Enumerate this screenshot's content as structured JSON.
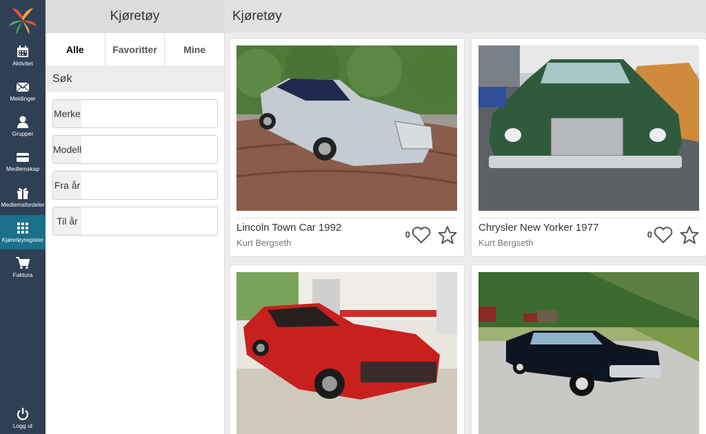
{
  "nav": {
    "items": [
      {
        "label": "Aktivitet",
        "icon": "calendar-icon"
      },
      {
        "label": "Meldinger",
        "icon": "envelope-icon"
      },
      {
        "label": "Grupper",
        "icon": "person-icon"
      },
      {
        "label": "Medlemskap",
        "icon": "card-icon"
      },
      {
        "label": "Medlemsfordeler",
        "icon": "gift-icon"
      },
      {
        "label": "Kjøretøyregister",
        "icon": "grid-icon"
      },
      {
        "label": "Faktura",
        "icon": "cart-icon"
      }
    ],
    "logout_label": "Logg ut",
    "active_index": 5
  },
  "panel": {
    "title": "Kjøretøy",
    "tabs": [
      "Alle",
      "Favoritter",
      "Mine"
    ],
    "active_tab": "Alle",
    "search_label": "Søk",
    "fields": [
      {
        "label": "Merke",
        "value": ""
      },
      {
        "label": "Modell",
        "value": ""
      },
      {
        "label": "Fra år",
        "value": ""
      },
      {
        "label": "Til år",
        "value": ""
      }
    ]
  },
  "main": {
    "title": "Kjøretøy",
    "cards": [
      {
        "title": "Lincoln Town Car 1992",
        "owner": "Kurt Bergseth",
        "likes": "0",
        "body_color": "#c4cbd2"
      },
      {
        "title": "Chrysler New Yorker 1977",
        "owner": "Kurt Bergseth",
        "likes": "0",
        "body_color": "#2f5a3c"
      },
      {
        "title": "",
        "owner": "",
        "likes": "",
        "body_color": "#c8201d"
      },
      {
        "title": "",
        "owner": "",
        "likes": "",
        "body_color": "#0e1420"
      }
    ]
  },
  "colors": {
    "nav_bg": "#2f4055",
    "nav_active": "#1a6f8a"
  }
}
